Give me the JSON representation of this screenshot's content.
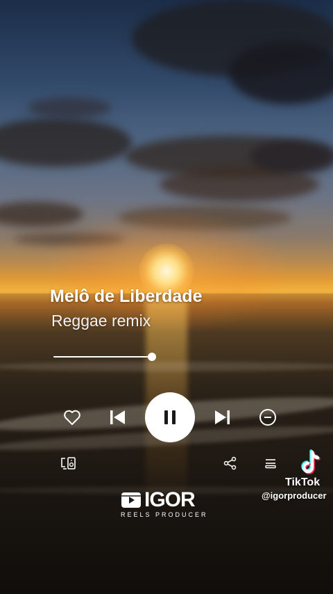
{
  "song": {
    "title": "Melô de Liberdade",
    "subtitle": "Reggae remix"
  },
  "player": {
    "progress_fraction": 1.0,
    "state": "playing",
    "controls": [
      "heart-icon",
      "skip-previous-icon",
      "pause-icon",
      "skip-next-icon",
      "minus-circle-icon"
    ],
    "secondary_controls": [
      "cast-device-icon",
      "share-icon",
      "queue-icon"
    ]
  },
  "watermark": {
    "brand": "TikTok",
    "username": "@igorproducer"
  },
  "logo": {
    "main": "IGOR",
    "sub": "REELS PRODUCER"
  },
  "colors": {
    "text": "#ffffff",
    "play_button": "#ffffff",
    "tiktok_cyan": "#25F4EE",
    "tiktok_red": "#FE2C55"
  }
}
